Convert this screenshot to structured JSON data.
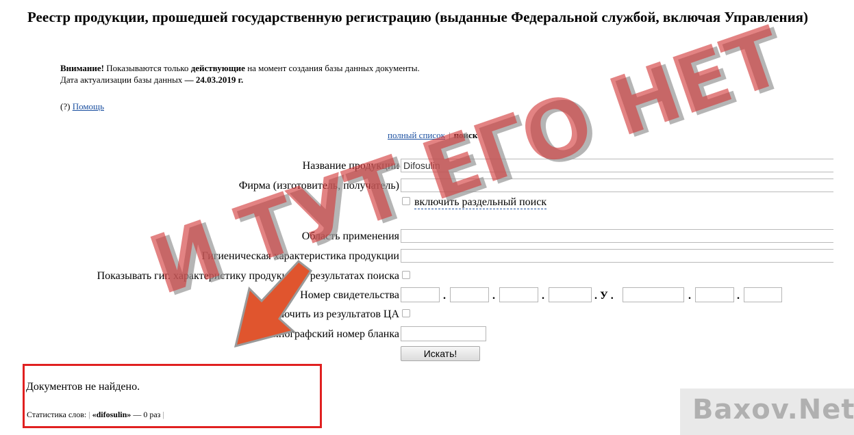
{
  "page": {
    "title": "Реестр продукции, прошедшей государственную регистрацию (выданные Федеральной службой, включая Управления)"
  },
  "notice": {
    "attention": "Внимание!",
    "text1": " Показываются только ",
    "active": "действующие",
    "text2": " на момент создания базы данных документы.",
    "date_text": "Дата актуализации базы данных ",
    "date_value": "— 24.03.2019 г."
  },
  "help": {
    "prefix": "(?) ",
    "link": "Помощь"
  },
  "nav": {
    "full_list": "полный список",
    "separator": "|",
    "search": "поиск"
  },
  "form": {
    "product_name_label": "Название продукции",
    "product_name_value": "Difosulin",
    "firm_label": "Фирма (изготовитель, получатель)",
    "firm_value": "",
    "separate_search_label": "включить раздельный поиск",
    "area_label": "Область применения",
    "hygiene_label": "Гигиеническая характеристика продукции",
    "show_hygiene_label": "Показывать гиг. характеристику продукции в результатах поиска",
    "certificate_label": "Номер свидетельства",
    "cert_dot": ".",
    "cert_u": ". У .",
    "exclude_label": "Исключить из результатов ЦА",
    "blank_label": "Типографский номер бланка",
    "search_button": "Искать!"
  },
  "result": {
    "message": "Документов не найдено.",
    "stats_label": "Статистика слов:",
    "bar": "|",
    "term": "«difosulin»",
    "count": " — 0 раз"
  },
  "overlay": {
    "watermark": "И ТУТ ЕГО НЕТ",
    "site": "Baxov.Net",
    "colors": {
      "watermark": "#d23737",
      "arrow": "#e0552e",
      "box": "#e02020"
    }
  }
}
